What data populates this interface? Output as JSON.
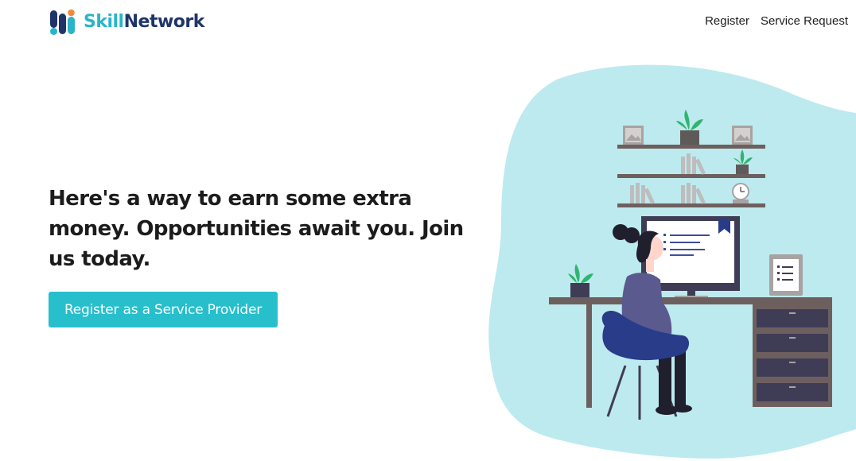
{
  "header": {
    "brand": {
      "name_part1": "Skill",
      "name_part2": "Network"
    },
    "nav": {
      "register_label": "Register",
      "service_request_label": "Service Request"
    }
  },
  "hero": {
    "heading": "Here's a way to earn some extra money. Opportunities await you. Join us today.",
    "cta_label": "Register as a Service Provider"
  },
  "colors": {
    "accent": "#27bfcc",
    "brand_dark": "#1f3569",
    "blob": "#bdeaee"
  }
}
